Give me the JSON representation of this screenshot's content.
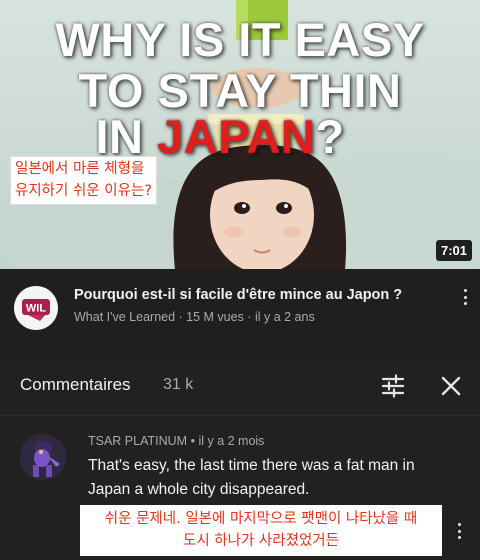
{
  "thumbnail": {
    "title_line1": "WHY IS IT EASY",
    "title_line2": "TO STAY THIN",
    "title_line3_prefix": "IN ",
    "title_line3_highlight": "JAPAN",
    "title_line3_suffix": "?",
    "korean_caption_line1": "일본에서 마른 체형을",
    "korean_caption_line2": "유지하기 쉬운 이유는?",
    "duration": "7:01",
    "highlight_color": "#e11d1d"
  },
  "video": {
    "channel_logo_text": "WIL",
    "title": "Pourquoi est-il si facile d'être mince au Japon ?",
    "meta": "What I've Learned · 15 M vues · il y a 2 ans"
  },
  "comments": {
    "title": "Commentaires",
    "count": "31 k",
    "items": [
      {
        "author": "TSAR PLATINUM",
        "time": "il y a 2 mois",
        "text": "That's easy, the last time there was a fat man in Japan a whole city disappeared.",
        "korean_caption_line1": "쉬운 문제네. 일본에 마지막으로 팻맨이 나타났을 때",
        "korean_caption_line2": "도시 하나가 사라졌었거든"
      }
    ]
  },
  "icons": [
    "more-vert-icon",
    "sort-icon",
    "close-icon"
  ]
}
